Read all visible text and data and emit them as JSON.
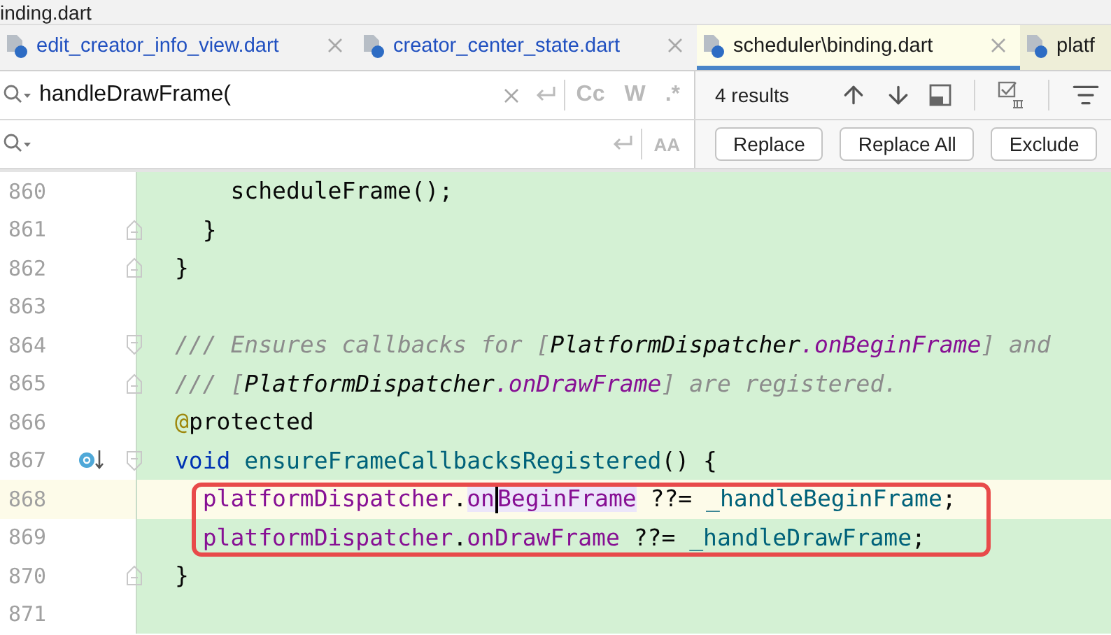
{
  "window": {
    "title": "inding.dart"
  },
  "tabs": [
    {
      "label": "edit_creator_info_view.dart",
      "selected": false,
      "color": "#2050c0",
      "closable": true
    },
    {
      "label": "creator_center_state.dart",
      "selected": false,
      "color": "#2050c0",
      "closable": true
    },
    {
      "label": "scheduler\\binding.dart",
      "selected": true,
      "color": "#1a1a1a",
      "closable": true
    },
    {
      "label": "platf",
      "selected": false,
      "color": "#1a1a1a",
      "closable": false
    }
  ],
  "search": {
    "value": "handleDrawFrame(",
    "toggles": [
      {
        "label": "Cc",
        "on": false
      },
      {
        "label": "W",
        "on": false
      },
      {
        "label": ".*",
        "on": false
      }
    ],
    "results": "4 results"
  },
  "replace": {
    "toggles": [
      {
        "label": "AA",
        "on": false
      }
    ],
    "buttons": [
      "Replace",
      "Replace All",
      "Exclude"
    ]
  },
  "code": {
    "blocks": [
      {
        "boxed": false,
        "lines": [
          {
            "number": "860",
            "fold_start": false,
            "fold_end": false,
            "marker": false,
            "current": false,
            "tokens": [
              {
                "t": "    scheduleFrame();",
                "kind": "plain"
              }
            ]
          },
          {
            "number": "861",
            "fold_start": false,
            "fold_end": true,
            "marker": false,
            "current": false,
            "tokens": [
              {
                "t": "  }",
                "kind": "plain"
              }
            ]
          },
          {
            "number": "862",
            "fold_start": false,
            "fold_end": true,
            "marker": false,
            "current": false,
            "tokens": [
              {
                "t": "}",
                "kind": "plain"
              }
            ]
          },
          {
            "number": "863",
            "fold_start": false,
            "fold_end": false,
            "marker": false,
            "current": false
          },
          {
            "number": "864",
            "fold_start": true,
            "fold_end": false,
            "marker": false,
            "current": false,
            "tokens": [
              {
                "t": "/// Ensures callbacks for [",
                "kind": "comment"
              },
              {
                "t": "PlatformDispatcher",
                "kind": "ref"
              },
              {
                "t": ".onBeginFrame",
                "kind": "docfield"
              },
              {
                "t": "] and",
                "kind": "comment"
              }
            ]
          },
          {
            "number": "865",
            "fold_start": false,
            "fold_end": true,
            "marker": false,
            "current": false,
            "tokens": [
              {
                "t": "/// [",
                "kind": "comment"
              },
              {
                "t": "PlatformDispatcher",
                "kind": "ref"
              },
              {
                "t": ".onDrawFrame",
                "kind": "docfield"
              },
              {
                "t": "] are registered.",
                "kind": "comment"
              }
            ]
          },
          {
            "number": "866",
            "fold_start": false,
            "fold_end": false,
            "marker": false,
            "current": false,
            "tokens": [
              {
                "t": "@",
                "kind": "annotation"
              },
              {
                "t": "protected",
                "kind": "plain"
              }
            ]
          },
          {
            "number": "867",
            "fold_start": true,
            "fold_end": false,
            "marker": true,
            "current": false,
            "tokens": [
              {
                "t": "void",
                "kind": "keyword"
              },
              {
                "t": " ensureFrameCallbacksRegistered",
                "kind": "func"
              },
              {
                "t": "() {",
                "kind": "plain"
              }
            ]
          }
        ]
      },
      {
        "boxed": true,
        "lines": [
          {
            "number": "868",
            "fold_start": false,
            "fold_end": false,
            "marker": false,
            "current": true,
            "tokens": [
              {
                "t": "  platformDispatcher",
                "kind": "field"
              },
              {
                "t": ".",
                "kind": "plain"
              },
              {
                "t": "on",
                "kind": "field",
                "highlighted": true
              },
              {
                "t": "BeginFrame",
                "kind": "field",
                "highlighted": true,
                "caret": true
              },
              {
                "t": " ??= ",
                "kind": "plain"
              },
              {
                "t": "_handleBeginFrame",
                "kind": "func"
              },
              {
                "t": ";",
                "kind": "plain"
              }
            ]
          },
          {
            "number": "869",
            "fold_start": false,
            "fold_end": false,
            "marker": false,
            "current": false,
            "tokens": [
              {
                "t": "  platformDispatcher",
                "kind": "field"
              },
              {
                "t": ".",
                "kind": "plain"
              },
              {
                "t": "onDrawFrame",
                "kind": "field"
              },
              {
                "t": " ??= ",
                "kind": "plain"
              },
              {
                "t": "_handleDrawFrame",
                "kind": "func"
              },
              {
                "t": ";",
                "kind": "plain"
              }
            ]
          }
        ]
      },
      {
        "boxed": false,
        "lines": [
          {
            "number": "870",
            "fold_start": false,
            "fold_end": true,
            "marker": false,
            "current": false,
            "tokens": [
              {
                "t": "}",
                "kind": "plain"
              }
            ]
          },
          {
            "number": "871",
            "fold_start": false,
            "fold_end": false,
            "marker": false,
            "current": false
          }
        ]
      }
    ]
  }
}
